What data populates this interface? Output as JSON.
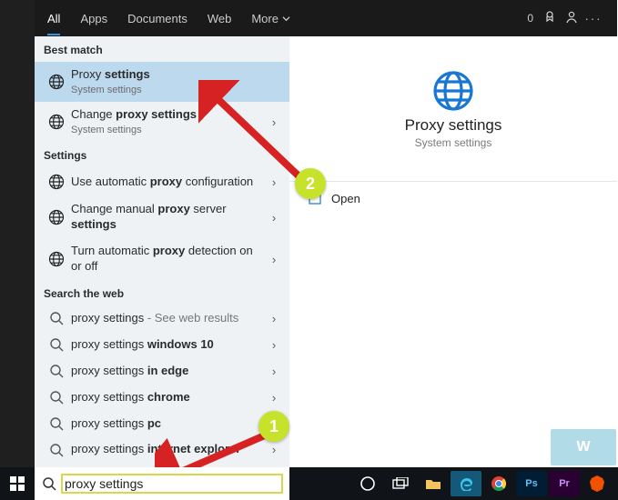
{
  "top_bar": {
    "tabs": [
      "All",
      "Apps",
      "Documents",
      "Web",
      "More"
    ],
    "badge": "0"
  },
  "sections": {
    "best_match": "Best match",
    "settings": "Settings",
    "search_web": "Search the web"
  },
  "best_match_items": [
    {
      "title_pre": "Proxy",
      "title_bold": " settings",
      "title_post": "",
      "sub": "System settings"
    },
    {
      "title_pre": "Change ",
      "title_bold": "proxy settings",
      "title_post": "",
      "sub": "System settings"
    }
  ],
  "settings_items": [
    {
      "pre": "Use automatic ",
      "bold": "proxy",
      "post": " configuration"
    },
    {
      "pre": "Change manual ",
      "bold": "proxy",
      "post": " server ",
      "bold2": "settings"
    },
    {
      "pre": "Turn automatic ",
      "bold": "proxy",
      "post": " detection on or off"
    }
  ],
  "web_items": [
    {
      "text": "proxy settings",
      "suffix": " - See web results"
    },
    {
      "text": "proxy settings ",
      "bold": "windows 10"
    },
    {
      "text": "proxy settings ",
      "bold": "in edge"
    },
    {
      "text": "proxy settings ",
      "bold": "chrome"
    },
    {
      "text": "proxy settings ",
      "bold": "pc"
    },
    {
      "text": "proxy settings ",
      "bold": "internet explorer"
    }
  ],
  "detail": {
    "title": "Proxy settings",
    "sub": "System settings",
    "action_open": "Open"
  },
  "search": {
    "value": "proxy settings"
  },
  "annotations": {
    "badge1": "1",
    "badge2": "2"
  },
  "watermark": "W"
}
